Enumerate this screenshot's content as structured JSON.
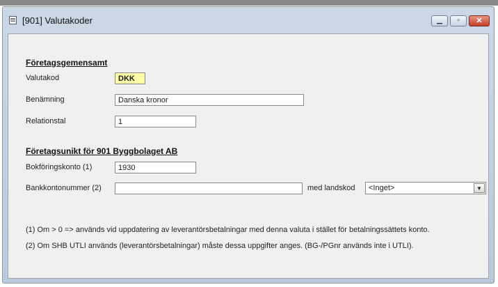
{
  "window": {
    "title": "[901] Valutakoder",
    "minimize_glyph": "▁",
    "maximize_glyph": "▫",
    "close_glyph": "✕"
  },
  "company_common": {
    "heading": "Företagsgemensamt",
    "currency_code_label": "Valutakod",
    "currency_code_value": "DKK",
    "name_label": "Benämning",
    "name_value": "Danska kronor",
    "ratio_label": "Relationstal",
    "ratio_value": "1"
  },
  "company_specific": {
    "heading": "Företagsunikt för 901 Byggbolaget AB",
    "account_label": "Bokföringskonto (1)",
    "account_value": "1930",
    "bank_account_label": "Bankkontonummer (2)",
    "bank_account_value": "",
    "country_code_label": "med landskod",
    "country_code_value": "<Inget>",
    "dropdown_glyph": "▼"
  },
  "notes": {
    "note1": "(1) Om > 0 => används vid uppdatering av leverantörsbetalningar med denna valuta i stället för betalningssättets konto.",
    "note2": "(2) Om SHB UTLI används (leverantörsbetalningar) måste dessa uppgifter anges. (BG-/PGnr används inte i UTLI)."
  }
}
